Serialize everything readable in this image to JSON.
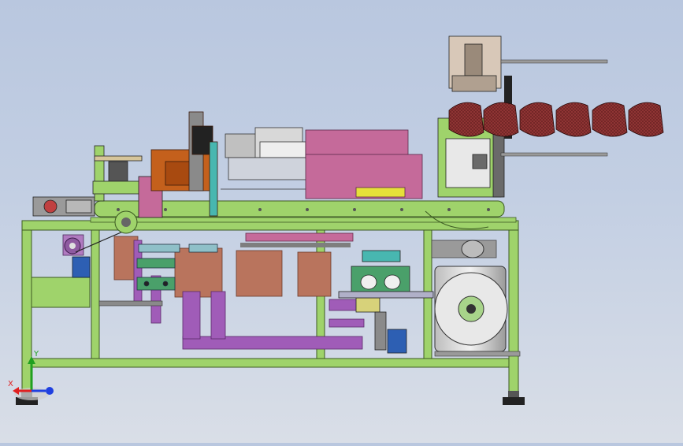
{
  "viewport": {
    "model": "mask-production-machine-assembly",
    "view": "front",
    "background_top": "#b9c7df",
    "background_bottom": "#d9dee7"
  },
  "colors": {
    "frame": "#9fd36b",
    "frame_edge": "#3c5a22",
    "pink": "#c56a9a",
    "magenta": "#a05cb8",
    "brown": "#b9745d",
    "orange": "#c4601c",
    "mask": "#7a2a2a",
    "motor": "#d8d8d8",
    "blue": "#2d5fb3",
    "teal": "#48b7b0",
    "yellow": "#e6e03a",
    "gray": "#8a8a8a"
  },
  "masks_count": 6,
  "triad": {
    "x_label": "X",
    "y_label": "Y",
    "x_color": "#e02020",
    "y_color": "#20a020",
    "z_color": "#2040e0"
  }
}
